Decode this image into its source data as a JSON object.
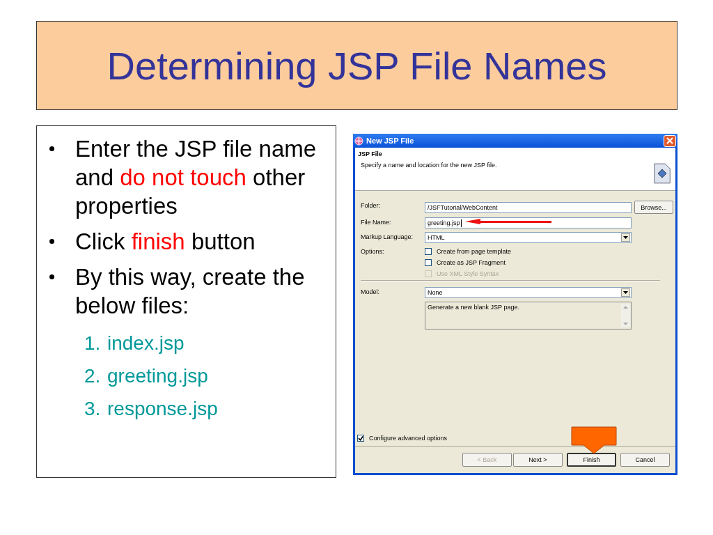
{
  "title": "Determining JSP File Names",
  "bullets": [
    {
      "parts": [
        {
          "text": "Enter the JSP file name and ",
          "highlight": false
        },
        {
          "text": "do not touch",
          "highlight": true
        },
        {
          "text": " other properties",
          "highlight": false
        }
      ]
    },
    {
      "parts": [
        {
          "text": "Click ",
          "highlight": false
        },
        {
          "text": "finish",
          "highlight": true
        },
        {
          "text": " button",
          "highlight": false
        }
      ]
    },
    {
      "parts": [
        {
          "text": "By this way, create the below files:",
          "highlight": false
        }
      ]
    }
  ],
  "files": [
    {
      "number": "1.",
      "name": "index.jsp"
    },
    {
      "number": "2.",
      "name": "greeting.jsp"
    },
    {
      "number": "3.",
      "name": "response.jsp"
    }
  ],
  "dialog": {
    "title": "New JSP File",
    "header": {
      "title": "JSP File",
      "description": "Specify a name and location for the new JSP file."
    },
    "folder": {
      "label": "Folder:",
      "value": "/JSFTutorial/WebContent",
      "button": "Browse..."
    },
    "file_name": {
      "label": "File Name:",
      "value": "greeting.jsp"
    },
    "markup_language": {
      "label": "Markup Language:",
      "value": "HTML"
    },
    "options": {
      "label": "Options:",
      "items": [
        {
          "label": "Create from page template",
          "checked": false,
          "disabled": false
        },
        {
          "label": "Create as JSP Fragment",
          "checked": false,
          "disabled": false
        },
        {
          "label": "Use XML Style Syntax",
          "checked": false,
          "disabled": true
        }
      ]
    },
    "model": {
      "label": "Model:",
      "value": "None",
      "description": "Generate a new blank JSP page."
    },
    "advanced": {
      "label": "Configure advanced options",
      "checked": true
    },
    "buttons": [
      {
        "label": "< Back",
        "disabled": true,
        "default": false
      },
      {
        "label": "Next >",
        "disabled": false,
        "default": false
      },
      {
        "label": "Finish",
        "disabled": false,
        "default": true
      },
      {
        "label": "Cancel",
        "disabled": false,
        "default": false
      }
    ]
  }
}
